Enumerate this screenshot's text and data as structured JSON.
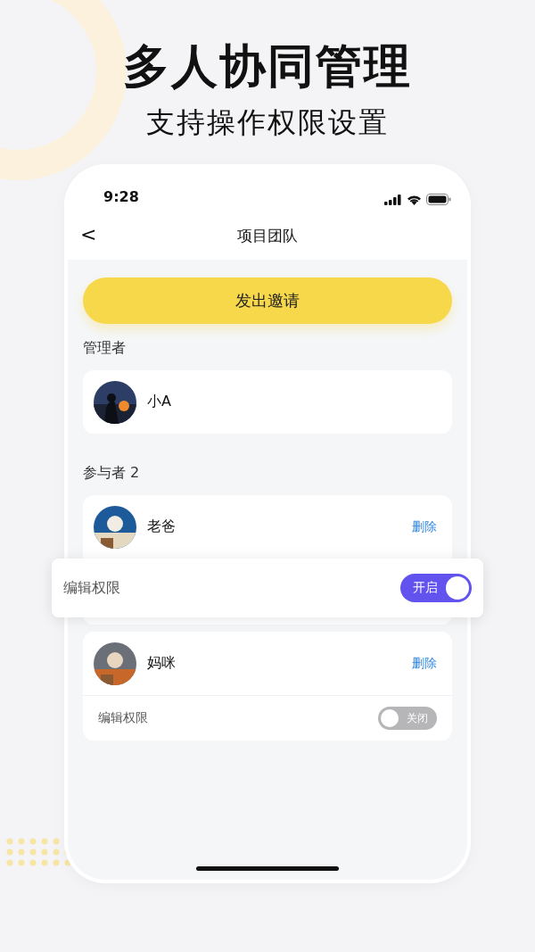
{
  "headline": "多人协同管理",
  "subheadline": "支持操作权限设置",
  "status_bar": {
    "time": "9:28"
  },
  "nav": {
    "back": "<",
    "title": "项目团队"
  },
  "invite_button": "发出邀请",
  "managers": {
    "label": "管理者",
    "members": [
      {
        "name": "小A"
      }
    ]
  },
  "participants": {
    "label": "参与者 2",
    "members": [
      {
        "name": "老爸",
        "action": "删除",
        "permission": {
          "label": "编辑权限",
          "on": true,
          "state_text": "开启"
        },
        "highlighted": true
      },
      {
        "name": "妈咪",
        "action": "删除",
        "permission": {
          "label": "编辑权限",
          "on": false,
          "state_text": "关闭"
        },
        "highlighted": false
      }
    ]
  }
}
